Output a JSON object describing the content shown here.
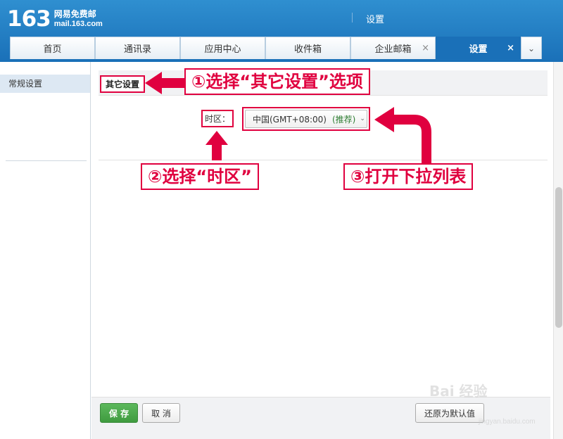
{
  "header": {
    "logo_number": "163",
    "logo_cn": "网易免费邮",
    "logo_en": "mail.163.com",
    "title": "设置"
  },
  "tabs": [
    {
      "label": "首页",
      "closable": false,
      "active": false
    },
    {
      "label": "通讯录",
      "closable": false,
      "active": false
    },
    {
      "label": "应用中心",
      "closable": false,
      "active": false
    },
    {
      "label": "收件箱",
      "closable": false,
      "active": false
    },
    {
      "label": "企业邮箱",
      "closable": true,
      "active": false
    },
    {
      "label": "设置",
      "closable": true,
      "active": true
    }
  ],
  "tab_close_glyph": "×",
  "tab_more_glyph": "⌄",
  "sidebar": {
    "items": [
      {
        "label": "常规设置",
        "active": true
      }
    ]
  },
  "section": {
    "title": "其它设置",
    "timezone_label": "时区：",
    "timezone_value": "中国(GMT+08:00)",
    "timezone_recommend": "(推荐)",
    "chevron_glyph": "⌄"
  },
  "annotations": {
    "step1": "①选择“其它设置”选项",
    "step2": "②选择“时区”",
    "step3": "③打开下拉列表"
  },
  "footer": {
    "save_label": "保 存",
    "cancel_label": "取 消",
    "reset_label": "还原为默认值"
  },
  "watermark": {
    "text": "Bai 经验",
    "sub": "jingyan.baidu.com"
  },
  "colors": {
    "brand_blue": "#1a70b8",
    "annotation_red": "#e0003f",
    "save_green": "#4cae4c"
  }
}
